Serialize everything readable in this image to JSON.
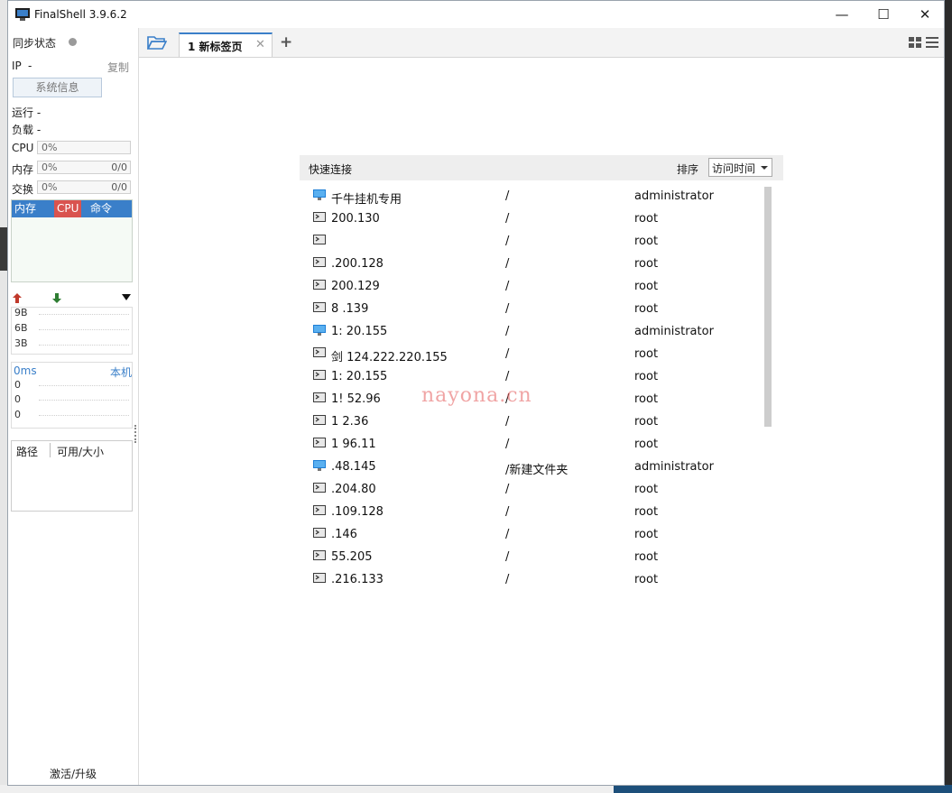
{
  "window": {
    "title": "FinalShell 3.9.6.2"
  },
  "sidebar": {
    "sync_label": "同步状态",
    "ip_label": "IP",
    "ip_value": "-",
    "copy_label": "复制",
    "sysinfo_button": "系统信息",
    "run_label": "运行 -",
    "load_label": "负载 -",
    "cpu": {
      "label": "CPU",
      "pct": "0%"
    },
    "mem": {
      "label": "内存",
      "pct": "0%",
      "ratio": "0/0"
    },
    "swap": {
      "label": "交换",
      "pct": "0%",
      "ratio": "0/0"
    },
    "proc_tabs": [
      "内存",
      "CPU",
      "命令"
    ],
    "net_ticks": [
      "9B",
      "6B",
      "3B"
    ],
    "ping_latency": "0ms",
    "ping_target": "本机",
    "ping_ticks": [
      "0",
      "0",
      "0"
    ],
    "disk_cols": [
      "路径",
      "可用/大小"
    ],
    "activate_label": "激活/升级"
  },
  "tabs": [
    {
      "label": "1 新标签页"
    }
  ],
  "quick_connect": {
    "title": "快速连接",
    "sort_label": "排序",
    "sort_value": "访问时间",
    "rows": [
      {
        "icon": "windows-monitor-icon",
        "name": "千牛挂机专用",
        "path": "/",
        "user": "administrator"
      },
      {
        "icon": "terminal-icon",
        "name": "200.130",
        "path": "/",
        "user": "root"
      },
      {
        "icon": "terminal-icon",
        "name": "",
        "path": "/",
        "user": "root"
      },
      {
        "icon": "terminal-icon",
        "name": ".200.128",
        "path": "/",
        "user": "root"
      },
      {
        "icon": "terminal-icon",
        "name": "200.129",
        "path": "/",
        "user": "root"
      },
      {
        "icon": "terminal-icon",
        "name": "8 .139",
        "path": "/",
        "user": "root"
      },
      {
        "icon": "windows-monitor-icon",
        "name": "1: 20.155",
        "path": "/",
        "user": "administrator"
      },
      {
        "icon": "terminal-icon",
        "name": "剑 124.222.220.155",
        "path": "/",
        "user": "root"
      },
      {
        "icon": "terminal-icon",
        "name": "1: 20.155",
        "path": "/",
        "user": "root"
      },
      {
        "icon": "terminal-icon",
        "name": "1! 52.96",
        "path": "/",
        "user": "root"
      },
      {
        "icon": "terminal-icon",
        "name": "1 2.36",
        "path": "/",
        "user": "root"
      },
      {
        "icon": "terminal-icon",
        "name": "1 96.11",
        "path": "/",
        "user": "root"
      },
      {
        "icon": "windows-monitor-icon",
        "name": ".48.145",
        "path": "/新建文件夹",
        "user": "administrator"
      },
      {
        "icon": "terminal-icon",
        "name": ".204.80",
        "path": "/",
        "user": "root"
      },
      {
        "icon": "terminal-icon",
        "name": ".109.128",
        "path": "/",
        "user": "root"
      },
      {
        "icon": "terminal-icon",
        "name": ".146",
        "path": "/",
        "user": "root"
      },
      {
        "icon": "terminal-icon",
        "name": "55.205",
        "path": "/",
        "user": "root"
      },
      {
        "icon": "terminal-icon",
        "name": ".216.133",
        "path": "/",
        "user": "root"
      }
    ]
  },
  "watermark": "nayona.cn",
  "colors": {
    "accent": "#3a7fc9",
    "cpu_tab": "#d9534f",
    "up_arrow": "#c0392b",
    "down_arrow": "#2e7d32"
  }
}
